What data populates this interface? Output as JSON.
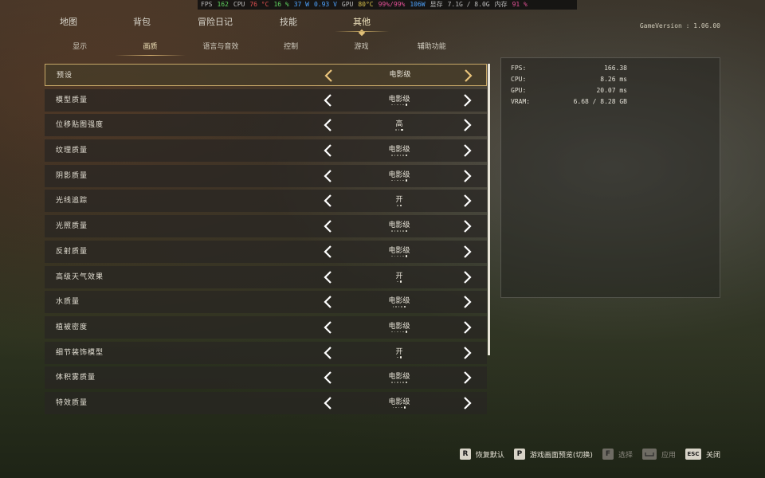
{
  "hud": {
    "fps_label": "FPS",
    "fps": "162",
    "cpu_label": "CPU",
    "cpu_temp": "76 °C",
    "cpu_load": "16 %",
    "cpu_power": "37 W",
    "cpu_volt": "0.93 V",
    "gpu_label": "GPU",
    "gpu_temp": "80°C",
    "gpu_load": "99%/99%",
    "gpu_power": "106W",
    "vram_label": "显存",
    "vram": "7.1G / 8.0G",
    "ram_label": "内存",
    "ram": "91 %"
  },
  "top_tabs": [
    "地图",
    "背包",
    "冒险日记",
    "技能",
    "其他"
  ],
  "game_version": "GameVersion : 1.06.00",
  "sub_tabs": [
    "显示",
    "画质",
    "语言与音效",
    "控制",
    "游戏",
    "辅助功能"
  ],
  "settings": [
    {
      "label": "预设",
      "value": "电影级",
      "dots": 0,
      "active": 0
    },
    {
      "label": "模型质量",
      "value": "电影级",
      "dots": 6,
      "active": 5
    },
    {
      "label": "位移贴图强度",
      "value": "高",
      "dots": 3,
      "active": 2
    },
    {
      "label": "纹理质量",
      "value": "电影级",
      "dots": 6,
      "active": 5
    },
    {
      "label": "阴影质量",
      "value": "电影级",
      "dots": 6,
      "active": 5
    },
    {
      "label": "光线追踪",
      "value": "开",
      "dots": 2,
      "active": 1
    },
    {
      "label": "光照质量",
      "value": "电影级",
      "dots": 6,
      "active": 5
    },
    {
      "label": "反射质量",
      "value": "电影级",
      "dots": 6,
      "active": 5
    },
    {
      "label": "高级天气效果",
      "value": "开",
      "dots": 2,
      "active": 1
    },
    {
      "label": "水质量",
      "value": "电影级",
      "dots": 5,
      "active": 4
    },
    {
      "label": "植被密度",
      "value": "电影级",
      "dots": 6,
      "active": 5
    },
    {
      "label": "细节装饰模型",
      "value": "开",
      "dots": 2,
      "active": 1
    },
    {
      "label": "体积雾质量",
      "value": "电影级",
      "dots": 6,
      "active": 5
    },
    {
      "label": "特效质量",
      "value": "电影级",
      "dots": 5,
      "active": 4
    }
  ],
  "stats": [
    {
      "label": "FPS:",
      "value": "166.38"
    },
    {
      "label": "CPU:",
      "value": "8.26 ms"
    },
    {
      "label": "GPU:",
      "value": "20.07 ms"
    },
    {
      "label": "VRAM:",
      "value": "6.68 / 8.28 GB"
    }
  ],
  "footer": {
    "reset_key": "R",
    "reset_label": "恢复默认",
    "preview_key": "P",
    "preview_label": "游戏画面预览(切换)",
    "select_key": "F",
    "select_label": "选择",
    "apply_label": "应用",
    "close_key": "ESC",
    "close_label": "关闭"
  },
  "colors": {
    "accent": "#c8a868",
    "selected_arrow": "#e8c27a"
  }
}
